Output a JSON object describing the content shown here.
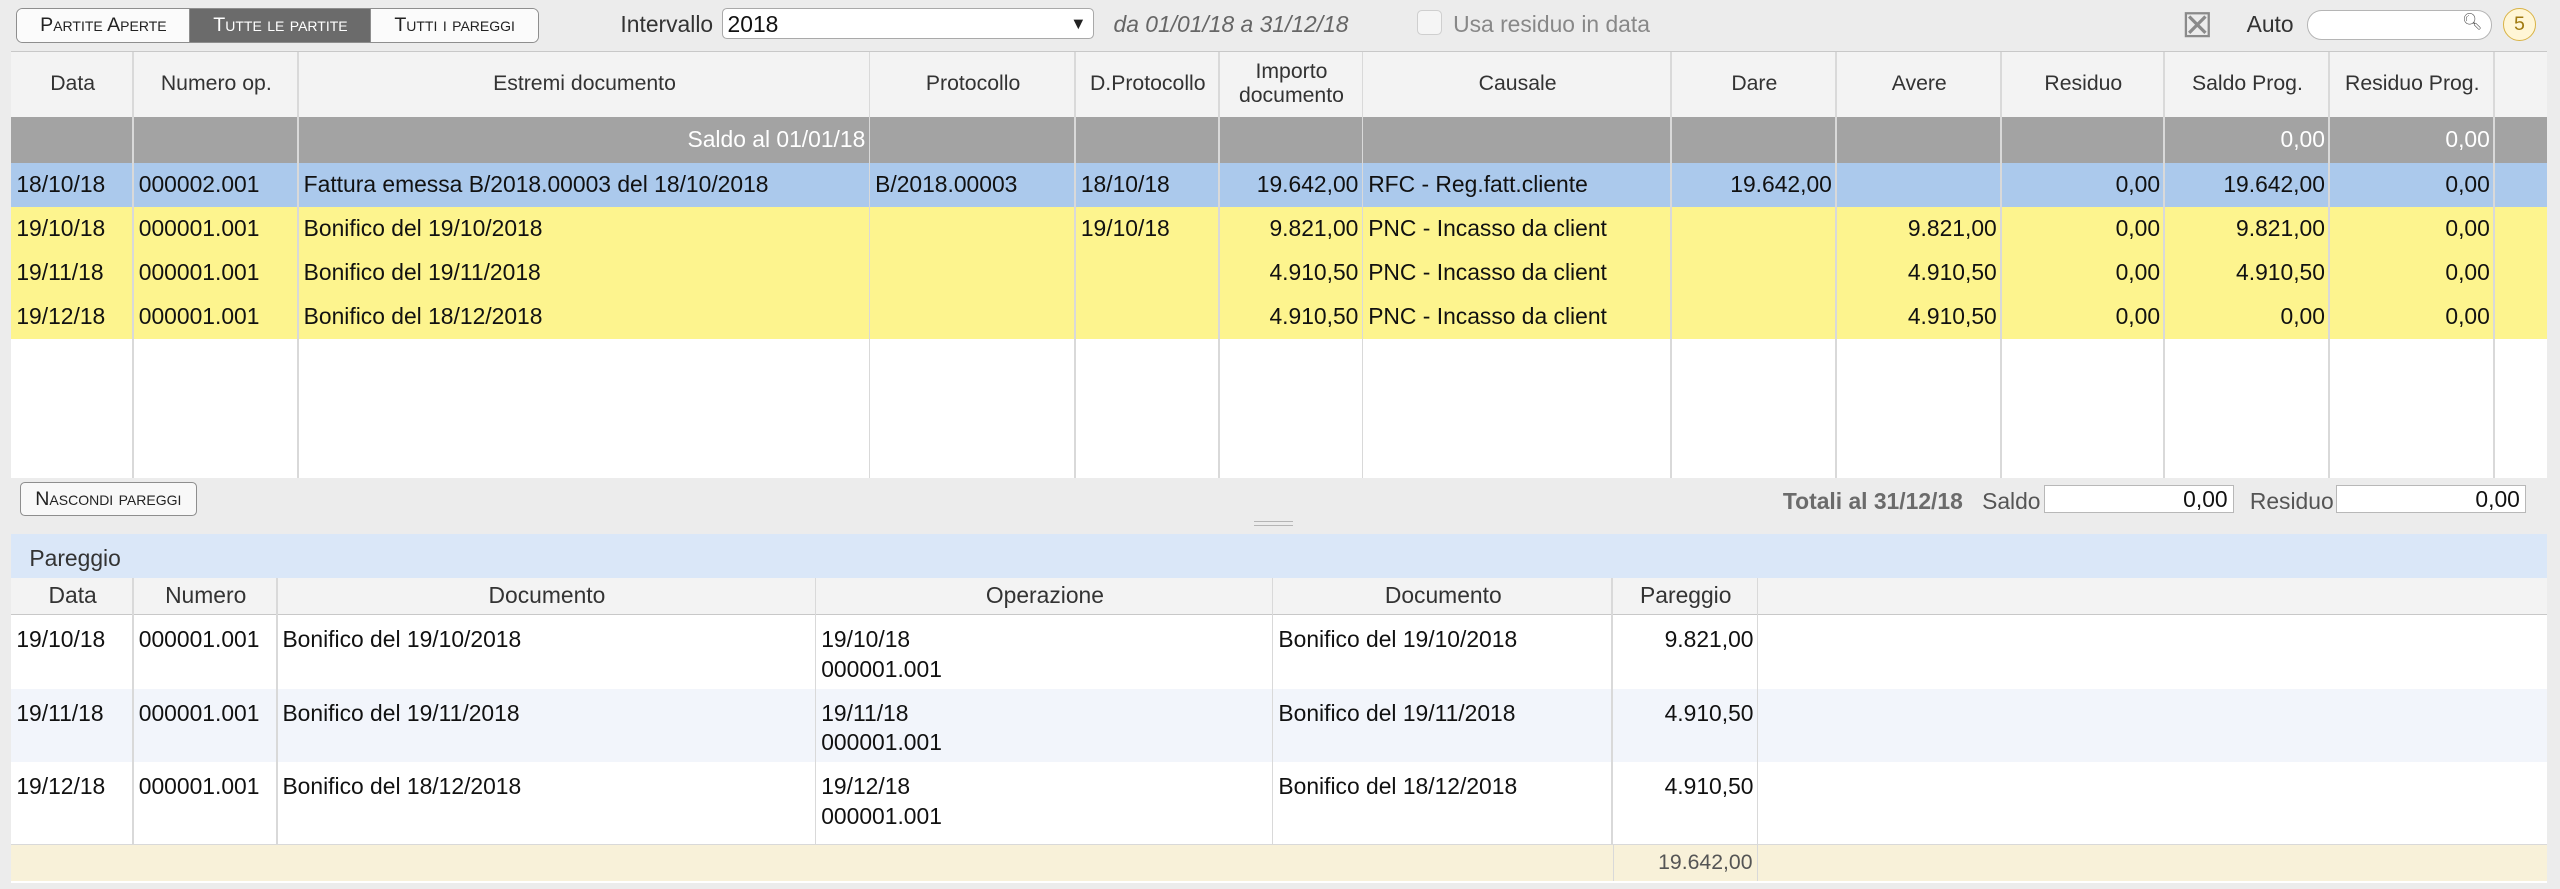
{
  "toolbar": {
    "seg_open": "Partite Aperte",
    "seg_all": "Tutte le partite",
    "seg_pareggi": "Tutti i pareggi",
    "interval_label": "Intervallo",
    "interval_value": "2018",
    "range_text": "da 01/01/18 a 31/12/18",
    "residuo_label": "Usa residuo in data",
    "auto_label": "Auto",
    "search_value": "",
    "badge": "5",
    "icon_excel": "excel-icon",
    "icon_search": "search-icon"
  },
  "grid": {
    "columns": [
      "Data",
      "Numero op.",
      "Estremi documento",
      "Protocollo",
      "D.Protocollo",
      "Importo documento",
      "Causale",
      "Dare",
      "Avere",
      "Residuo",
      "Saldo Prog.",
      "Residuo Prog."
    ],
    "saldo_row": {
      "label": "Saldo al 01/01/18",
      "saldo_prog": "0,00",
      "residuo_prog": "0,00"
    },
    "rows": [
      [
        "18/10/18",
        "000002.001",
        "Fattura emessa B/2018.00003 del 18/10/2018",
        "B/2018.00003",
        "18/10/18",
        "19.642,00",
        "RFC - Reg.fatt.cliente",
        "19.642,00",
        "",
        "0,00",
        "19.642,00",
        "0,00"
      ],
      [
        "19/10/18",
        "000001.001",
        "Bonifico del 19/10/2018",
        "",
        "19/10/18",
        "9.821,00",
        "PNC - Incasso da client",
        "",
        "9.821,00",
        "0,00",
        "9.821,00",
        "0,00"
      ],
      [
        "19/11/18",
        "000001.001",
        "Bonifico del 19/11/2018",
        "",
        "",
        "4.910,50",
        "PNC - Incasso da client",
        "",
        "4.910,50",
        "0,00",
        "4.910,50",
        "0,00"
      ],
      [
        "19/12/18",
        "000001.001",
        "Bonifico del 18/12/2018",
        "",
        "",
        "4.910,50",
        "PNC - Incasso da client",
        "",
        "4.910,50",
        "0,00",
        "0,00",
        "0,00"
      ]
    ],
    "row_colors": [
      "#abc9ec",
      "#fdf48e",
      "#fdf48e",
      "#fdf48e"
    ]
  },
  "bottom": {
    "hide_button": "Nascondi pareggi",
    "totali_label": "Totali al 31/12/18",
    "saldo_label": "Saldo",
    "saldo_value": "0,00",
    "residuo_label": "Residuo",
    "residuo_value": "0,00"
  },
  "pareggio": {
    "title": "Pareggio",
    "columns": [
      "Data",
      "Numero",
      "Documento",
      "Operazione",
      "Documento",
      "Pareggio"
    ],
    "rows": [
      [
        "19/10/18",
        "000001.001",
        "Bonifico del 19/10/2018",
        "19/10/18\n000001.001",
        "Bonifico del 19/10/2018",
        "9.821,00"
      ],
      [
        "19/11/18",
        "000001.001",
        "Bonifico del 19/11/2018",
        "19/11/18\n000001.001",
        "Bonifico del 19/11/2018",
        "4.910,50"
      ],
      [
        "19/12/18",
        "000001.001",
        "Bonifico del 18/12/2018",
        "19/12/18\n000001.001",
        "Bonifico del 18/12/2018",
        "4.910,50"
      ]
    ],
    "total": "19.642,00"
  }
}
